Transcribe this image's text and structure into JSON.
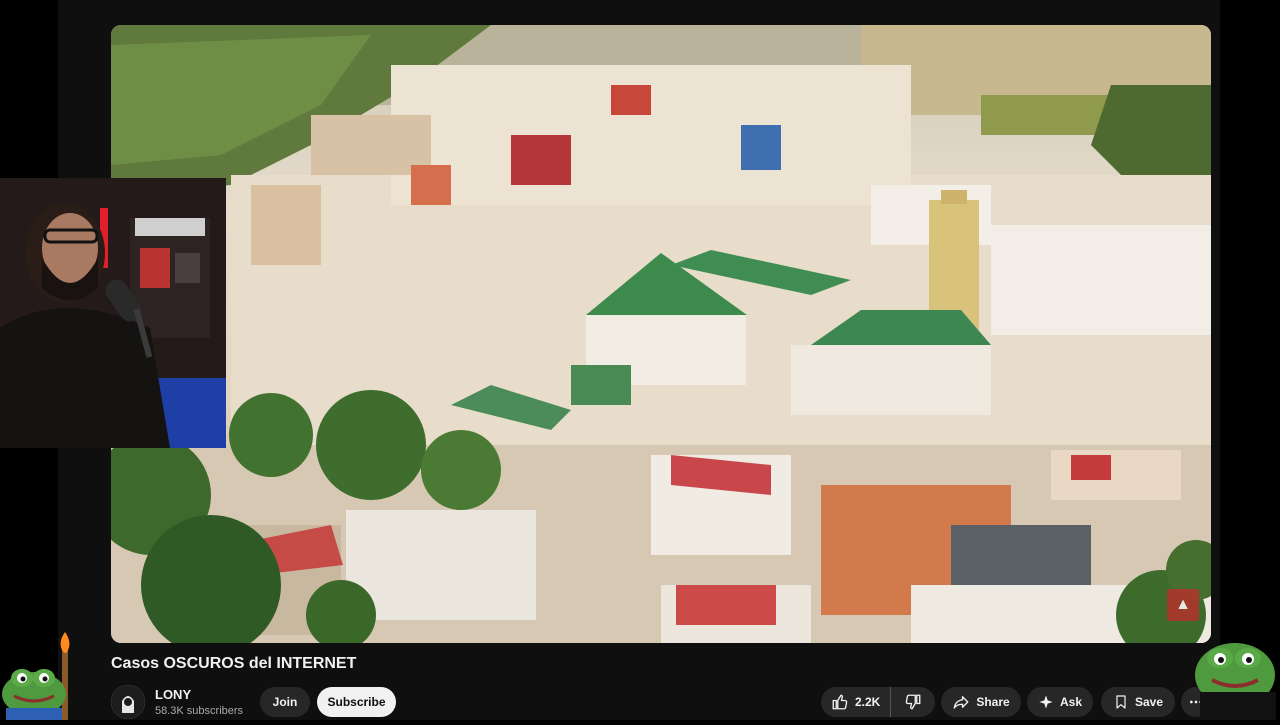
{
  "video": {
    "title": "Casos OSCUROS del INTERNET"
  },
  "channel": {
    "name": "LONY",
    "subscribers": "58.3K subscribers",
    "join_label": "Join",
    "subscribe_label": "Subscribe"
  },
  "actions": {
    "like_count": "2.2K",
    "share_label": "Share",
    "ask_label": "Ask",
    "save_label": "Save"
  },
  "icons": {
    "like": "thumbs-up-icon",
    "dislike": "thumbs-down-icon",
    "share": "share-arrow-icon",
    "ask": "sparkle-icon",
    "save": "bookmark-icon",
    "more": "more-dots-icon"
  },
  "colors": {
    "page_background": "#0f0f0f",
    "pill_background": "#272727",
    "subscribe_background": "#f1f1f1",
    "text_primary": "#f1f1f1",
    "text_secondary": "#aaaaaa"
  }
}
